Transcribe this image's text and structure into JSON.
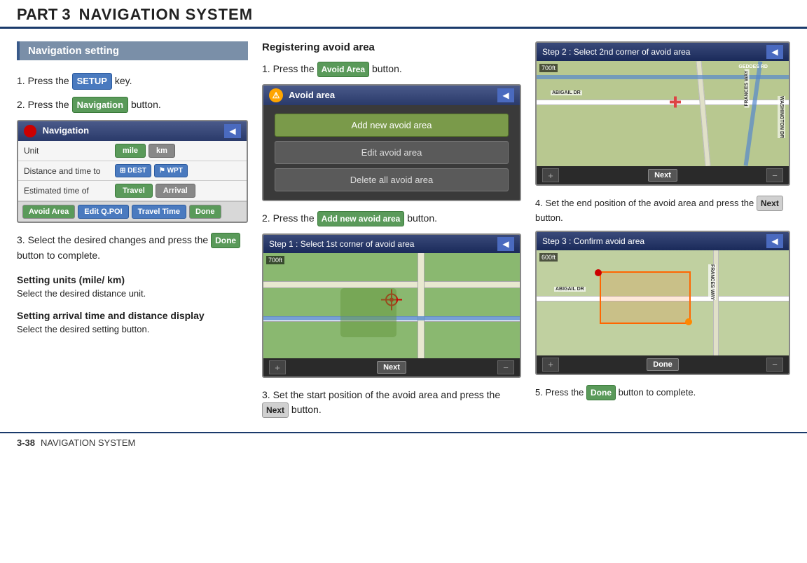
{
  "header": {
    "part": "PART 3",
    "title": "NAVIGATION SYSTEM"
  },
  "left": {
    "section_heading": "Navigation setting",
    "step1": "1. Press the",
    "step1_btn": "SETUP",
    "step1_end": "key.",
    "step2": "2. Press the",
    "step2_btn": "Navigation",
    "step2_end": "button.",
    "step3_a": "3. Select the desired changes and press the",
    "step3_btn": "Done",
    "step3_b": "button to complete.",
    "nav_screen_title": "Navigation",
    "nav_unit_label": "Unit",
    "nav_unit_mile": "mile",
    "nav_unit_km": "km",
    "nav_dist_label": "Distance and time to",
    "nav_dest": "DEST",
    "nav_wpt": "WPT",
    "nav_eta_label": "Estimated time of",
    "nav_travel": "Travel",
    "nav_arrival": "Arrival",
    "nav_avoid_area": "Avoid Area",
    "nav_edit_qpoi": "Edit Q.POI",
    "nav_travel_time": "Travel Time",
    "nav_done": "Done",
    "subsection1_title": "Setting units (mile/ km)",
    "subsection1_text": "Select the desired distance unit.",
    "subsection2_title": "Setting arrival time and distance display",
    "subsection2_text": "Select the desired setting button."
  },
  "middle": {
    "section_title": "Registering avoid area",
    "step1": "1. Press the",
    "step1_btn": "Avoid Area",
    "step1_end": "button.",
    "avoid_screen_title": "Avoid area",
    "avoid_menu1": "Add new avoid area",
    "avoid_menu2": "Edit avoid area",
    "avoid_menu3": "Delete all avoid area",
    "step2": "2. Press the",
    "step2_btn": "Add new avoid area",
    "step2_end": "button.",
    "map1_header": "Step 1 : Select 1st corner of avoid area",
    "map1_dist": "700ft",
    "map1_next": "Next",
    "step3_a": "3. Set the start position of the avoid area and press the",
    "step3_btn": "Next",
    "step3_b": "button."
  },
  "right": {
    "map2_header": "Step 2 : Select 2nd corner of avoid area",
    "map2_dist": "700ft",
    "map2_roads": [
      "ABIGAIL DR",
      "FRANCES WAY",
      "GEDDES RD",
      "WASHINGTON DR"
    ],
    "map2_next": "Next",
    "step4_a": "4. Set the end position of the avoid area and press the",
    "step4_btn": "Next",
    "step4_b": "button.",
    "map3_header": "Step 3 : Confirm avoid area",
    "map3_dist": "600ft",
    "map3_roads": [
      "ABIGAIL DR",
      "FRANCES WAY"
    ],
    "map3_done": "Done",
    "step5_a": "5. Press the",
    "step5_btn": "Done",
    "step5_b": "button to complete."
  },
  "footer": {
    "page": "3-38",
    "text": "NAVIGATION SYSTEM"
  }
}
